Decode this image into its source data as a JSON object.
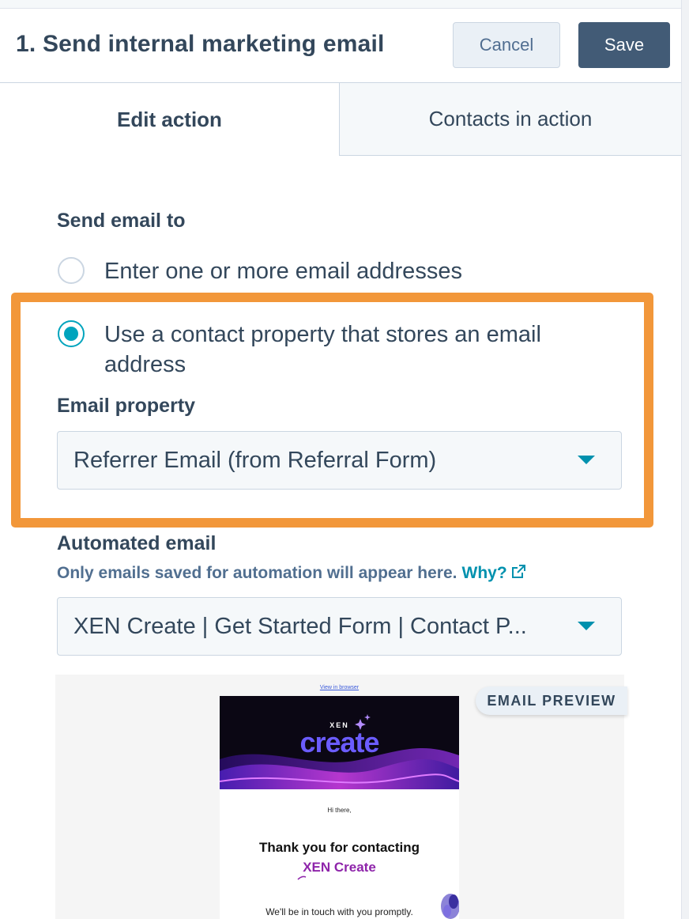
{
  "header": {
    "title": "1. Send internal marketing email",
    "cancel_label": "Cancel",
    "save_label": "Save"
  },
  "tabs": [
    {
      "label": "Edit action",
      "active": true
    },
    {
      "label": "Contacts in action",
      "active": false
    }
  ],
  "send_to": {
    "label": "Send email to",
    "options": [
      {
        "label": "Enter one or more email addresses",
        "selected": false
      },
      {
        "label": "Use a contact property that stores an email address",
        "selected": true
      }
    ]
  },
  "email_property": {
    "label": "Email property",
    "value": "Referrer Email (from Referral Form)"
  },
  "automated_email": {
    "label": "Automated email",
    "help_text": "Only emails saved for automation will appear here.",
    "help_link": "Why?",
    "value": "XEN Create | Get Started Form | Contact P..."
  },
  "preview": {
    "badge": "EMAIL PREVIEW",
    "view_in_browser": "View in browser",
    "brand_small": "XEN",
    "brand_logo": "create",
    "greeting": "Hi there,",
    "headline_line1": "Thank you for contacting",
    "headline_line2": "XEN Create",
    "body_text": "We'll be in touch with you promptly."
  },
  "colors": {
    "accent": "#00a4bd",
    "primary_button": "#425b76",
    "highlight": "#f2973a",
    "link": "#0091ae",
    "brand_purple": "#8e24aa"
  },
  "icons": [
    "radio-unchecked-icon",
    "radio-checked-icon",
    "chevron-down-icon",
    "external-link-icon"
  ]
}
